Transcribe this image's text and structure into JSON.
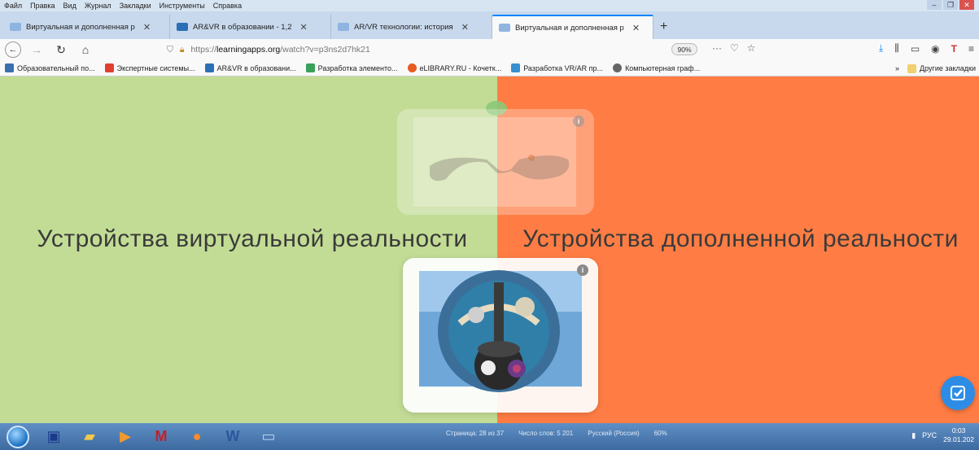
{
  "menu": [
    "Файл",
    "Правка",
    "Вид",
    "Журнал",
    "Закладки",
    "Инструменты",
    "Справка"
  ],
  "tabs": [
    {
      "label": "Виртуальная и дополненная р",
      "color": "#8fb4e0"
    },
    {
      "label": "AR&VR в образовании - 1,2",
      "color": "#2d6fb7"
    },
    {
      "label": "AR/VR технологии: история",
      "color": "#8fb4e0"
    },
    {
      "label": "Виртуальная и дополненная р",
      "color": "#8fb4e0",
      "active": true
    }
  ],
  "nav": {
    "url_prefix": "https://",
    "url_host": "learningapps.org",
    "url_path": "/watch?v=p3ns2d7hk21",
    "zoom": "90%",
    "dots": "···"
  },
  "bookmarks": [
    {
      "label": "Образовательный по...",
      "color": "#3a6fb0"
    },
    {
      "label": "Экспертные системы...",
      "color": "#e04030"
    },
    {
      "label": "AR&VR в образовани...",
      "color": "#2d6fb7"
    },
    {
      "label": "Разработка элементо...",
      "color": "#3aa05a"
    },
    {
      "label": "eLIBRARY.RU - Кочетк...",
      "color": "#e85a20"
    },
    {
      "label": "Разработка VR/AR пр...",
      "color": "#3a8fd0"
    },
    {
      "label": "Компьютерная граф...",
      "color": "#666666"
    }
  ],
  "bookmarks_other": "Другие закладки",
  "content": {
    "left_category": "Устройства виртуальной реальности",
    "right_category": "Устройства дополненной реальности",
    "left_color": "#c2dc95",
    "right_color": "#ff7d44",
    "check_color": "#2d8de6"
  },
  "taskbar": {
    "status_page": "Страница: 28 из 37",
    "status_words": "Число слов: 5 201",
    "status_lang": "Русский (Россия)",
    "status_zoom": "60%",
    "lang": "РУС",
    "time": "0:03",
    "date": "29.01.202"
  }
}
